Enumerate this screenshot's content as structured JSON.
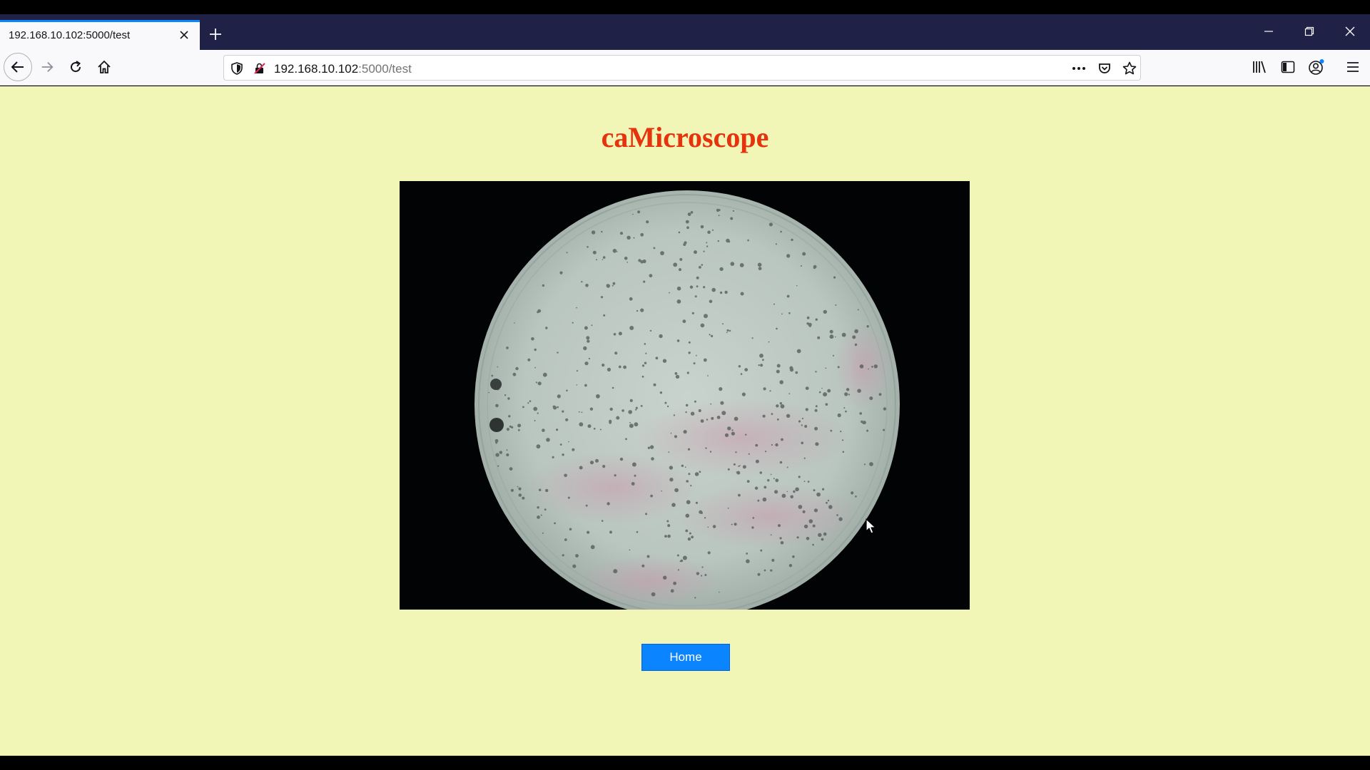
{
  "browser": {
    "tab": {
      "title": "192.168.10.102:5000/test"
    },
    "url": {
      "host": "192.168.10.102",
      "path": ":5000/test"
    },
    "accent_color": "#0a84ff",
    "tabstrip_color": "#1f2147"
  },
  "page": {
    "heading": "caMicroscope",
    "heading_color": "#e5330e",
    "background_color": "#f1f5b6",
    "home_button_label": "Home",
    "home_button_color": "#0a84ff"
  }
}
